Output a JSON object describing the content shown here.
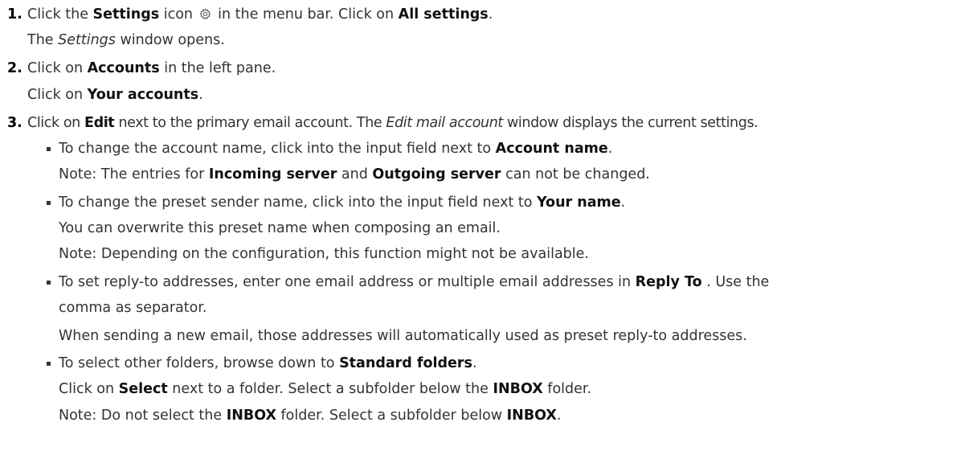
{
  "steps": [
    {
      "number": "1.",
      "lines": [
        {
          "a": "Click the ",
          "b": "Settings",
          "c": " icon ",
          "d": " in the menu bar. Click on ",
          "e": "All settings",
          "f": "."
        },
        {
          "a": "The ",
          "i": "Settings",
          "c": " window opens."
        }
      ]
    },
    {
      "number": "2.",
      "lines": [
        {
          "a": "Click on ",
          "b": "Accounts",
          "c": " in the left pane."
        },
        {
          "a": "Click on ",
          "b": "Your accounts",
          "c": "."
        }
      ]
    },
    {
      "number": "3.",
      "intro": {
        "a": "Click on ",
        "b": "Edit",
        "c": " next to the primary email account. The ",
        "i": "Edit mail account",
        "d": " window displays the current settings."
      },
      "bullets": [
        {
          "lines": [
            {
              "a": "To change the account name, click into the input field next to ",
              "b": "Account name",
              "c": "."
            },
            {
              "a": "Note: The entries for ",
              "b": "Incoming server",
              "c": " and ",
              "d": "Outgoing server",
              "e": " can not be changed."
            }
          ]
        },
        {
          "lines": [
            {
              "a": "To change the preset sender name, click into the input field next to ",
              "b": "Your name",
              "c": "."
            },
            {
              "a": "You can overwrite this preset name when composing an email."
            },
            {
              "a": "Note: Depending on the configuration, this function might not be available."
            }
          ]
        },
        {
          "lines": [
            {
              "a": "To set reply-to addresses, enter one email address or multiple email addresses in ",
              "b": "Reply To",
              "c": " . Use the"
            },
            {
              "a": "comma as separator."
            },
            {
              "a": "When sending a new email, those addresses will automatically used as preset reply-to addresses."
            }
          ]
        },
        {
          "lines": [
            {
              "a": "To select other folders, browse down to ",
              "b": "Standard folders",
              "c": "."
            },
            {
              "a": "Click on ",
              "b": "Select",
              "c": " next to a folder. Select a subfolder below the ",
              "d": "INBOX",
              "e": " folder."
            },
            {
              "a": "Note: Do not select the ",
              "b": "INBOX",
              "c": " folder. Select a subfolder below ",
              "d": "INBOX",
              "e": "."
            }
          ]
        }
      ]
    }
  ]
}
